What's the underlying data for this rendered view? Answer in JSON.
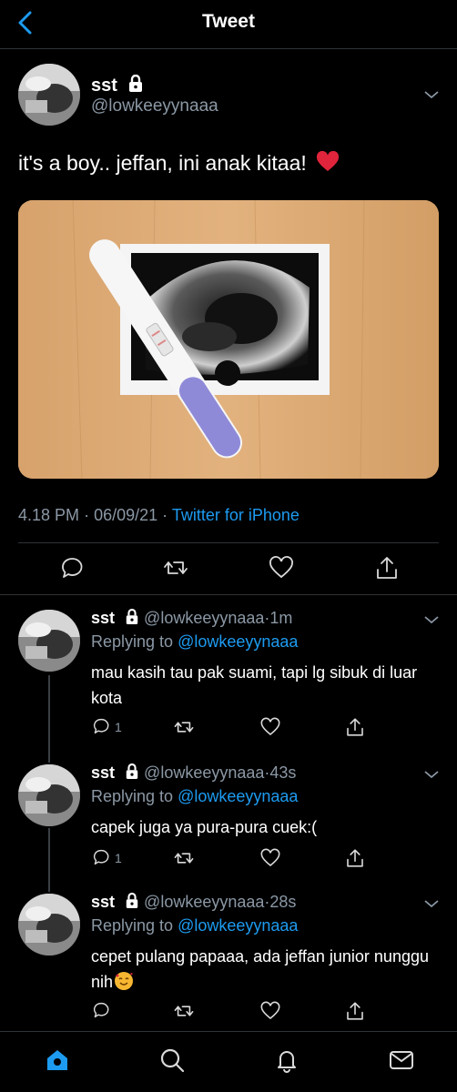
{
  "header": {
    "title": "Tweet"
  },
  "main_tweet": {
    "name": "sst",
    "handle": "@lowkeeyynaaa",
    "text": "it's a boy.. jeffan, ini anak kitaa!",
    "time": "4.18 PM",
    "date": "06/09/21",
    "dot": "·",
    "source": "Twitter for iPhone"
  },
  "replies": [
    {
      "name": "sst",
      "handle": "@lowkeeyynaaa",
      "time": "1m",
      "replying_label": "Replying to",
      "replying_to": "@lowkeeyynaaa",
      "text": "mau kasih tau pak suami, tapi lg sibuk di luar kota",
      "reply_count": "1"
    },
    {
      "name": "sst",
      "handle": "@lowkeeyynaaa",
      "time": "43s",
      "replying_label": "Replying to",
      "replying_to": "@lowkeeyynaaa",
      "text": "capek juga ya pura-pura cuek:(",
      "reply_count": "1"
    },
    {
      "name": "sst",
      "handle": "@lowkeeyynaaa",
      "time": "28s",
      "replying_label": "Replying to",
      "replying_to": "@lowkeeyynaaa",
      "text": "cepet pulang papaaa, ada jeffan junior nunggu nih",
      "reply_count": ""
    }
  ],
  "icons": {
    "back": "chevron-left-icon",
    "lock": "lock-icon",
    "reply": "reply-icon",
    "retweet": "retweet-icon",
    "like": "heart-icon",
    "share": "share-icon",
    "nav": [
      "home-icon",
      "search-icon",
      "notifications-icon",
      "messages-icon"
    ]
  },
  "colors": {
    "accent": "#1d9bf0",
    "muted": "#8b98a5",
    "background": "#000000",
    "divider": "#2f3336"
  }
}
